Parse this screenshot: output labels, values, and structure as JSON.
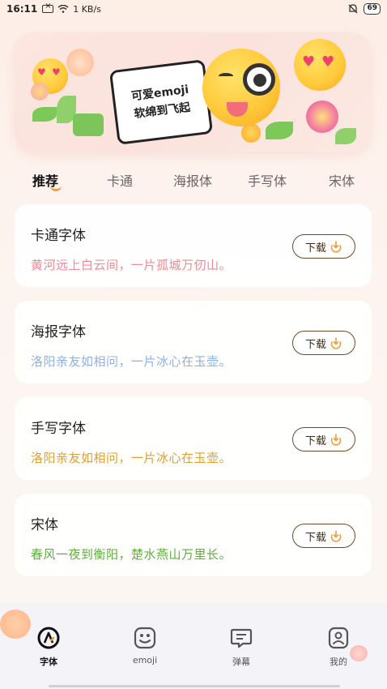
{
  "status_bar": {
    "time": "16:11",
    "speed": "1 KB/s",
    "battery": "69"
  },
  "banner": {
    "line1": "可爱emoji",
    "line2": "软绵到飞起"
  },
  "tabs": [
    {
      "label": "推荐",
      "active": true
    },
    {
      "label": "卡通",
      "active": false
    },
    {
      "label": "海报体",
      "active": false
    },
    {
      "label": "手写体",
      "active": false
    },
    {
      "label": "宋体",
      "active": false
    }
  ],
  "fonts": [
    {
      "title": "卡通字体",
      "sample": "黄河远上白云间，一片孤城万仞山。",
      "sample_color": "#f08a94",
      "button": "下载"
    },
    {
      "title": "海报字体",
      "sample": "洛阳亲友如相问，一片冰心在玉壶。",
      "sample_color": "#8fb0e6",
      "button": "下载"
    },
    {
      "title": "手写字体",
      "sample": "洛阳亲友如相问，一片冰心在玉壶。",
      "sample_color": "#e0a032",
      "button": "下载"
    },
    {
      "title": "宋体",
      "sample": "春风一夜到衡阳，楚水燕山万里长。",
      "sample_color": "#5fae3c",
      "button": "下载"
    }
  ],
  "bottom_nav": [
    {
      "label": "字体",
      "icon": "font-a-icon",
      "active": true
    },
    {
      "label": "emoji",
      "icon": "emoji-face-icon",
      "active": false
    },
    {
      "label": "弹幕",
      "icon": "chat-bubble-icon",
      "active": false
    },
    {
      "label": "我的",
      "icon": "profile-icon",
      "active": false
    }
  ],
  "colors": {
    "accent": "#f39a3a",
    "button_border": "#6b4a2c",
    "download_icon": "#f39a3a"
  }
}
